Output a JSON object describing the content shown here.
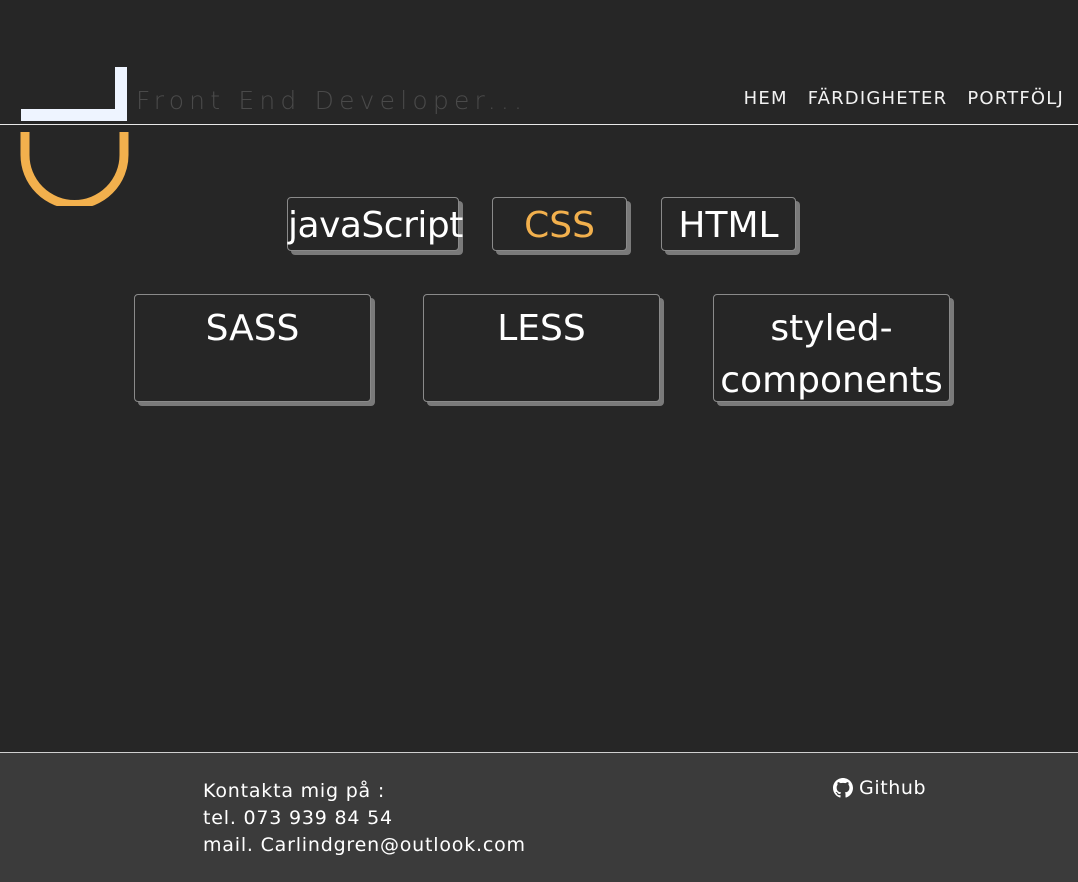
{
  "header": {
    "tagline": "Front End Developer...",
    "nav": [
      {
        "label": "HEM"
      },
      {
        "label": "FÄRDIGHETER"
      },
      {
        "label": "PORTFÖLJ"
      }
    ]
  },
  "skills": {
    "tabs": [
      {
        "label": "javaScript"
      },
      {
        "label": "CSS",
        "active": true
      },
      {
        "label": "HTML"
      }
    ],
    "cards": [
      {
        "label": "SASS"
      },
      {
        "label": "LESS"
      },
      {
        "label_line1": "styled-",
        "label_line2": "components"
      }
    ]
  },
  "footer": {
    "contact_heading": "Kontakta mig på :",
    "phone": "tel. 073 939 84 54",
    "email": "mail. Carlindgren@outlook.com",
    "github_label": "Github",
    "github_icon": "github-icon"
  },
  "colors": {
    "background": "#262626",
    "accent": "#f2b04d",
    "footer_bg": "#3b3b3b",
    "logo_light": "#eef4ff"
  }
}
